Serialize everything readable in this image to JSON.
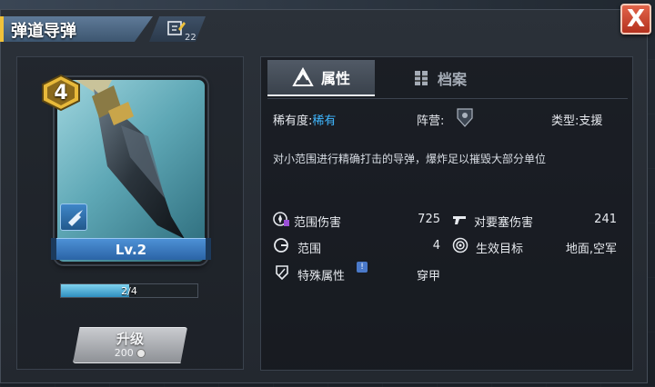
{
  "header": {
    "title": "弹道导弹",
    "edit_count": "22",
    "close_label": "X"
  },
  "card": {
    "star_level": "4",
    "level_label": "Lv.2",
    "fragments": "2/4",
    "fragments_fraction": 0.5,
    "icon": "missile",
    "type_icon": "unit-type-icon"
  },
  "upgrade": {
    "label": "升级",
    "cost": "200"
  },
  "tabs": [
    {
      "label": "属性",
      "icon": "attribute-icon",
      "active": true
    },
    {
      "label": "档案",
      "icon": "archive-icon",
      "active": false
    }
  ],
  "meta": {
    "rarity_label": "稀有度:",
    "rarity_value": "稀有",
    "faction_label": "阵营:",
    "type_label": "类型:",
    "type_value": "支援"
  },
  "description": "对小范围进行精确打击的导弹，爆炸足以摧毁大部分单位",
  "stats": [
    {
      "label": "范围伤害",
      "value": "725",
      "icon": "area-damage-icon"
    },
    {
      "label": "对要塞伤害",
      "value": "241",
      "icon": "fortress-damage-icon"
    },
    {
      "label": "范围",
      "value": "4",
      "icon": "range-icon"
    },
    {
      "label": "生效目标",
      "value": "地面,空军",
      "icon": "target-icon"
    },
    {
      "label": "特殊属性",
      "value": "穿甲",
      "icon": "shield-icon"
    }
  ],
  "colors": {
    "accent": "#3fb7ff",
    "title_bar": "#4f6a88",
    "close": "#c8422b",
    "level_bar": "#3b7ec4"
  }
}
